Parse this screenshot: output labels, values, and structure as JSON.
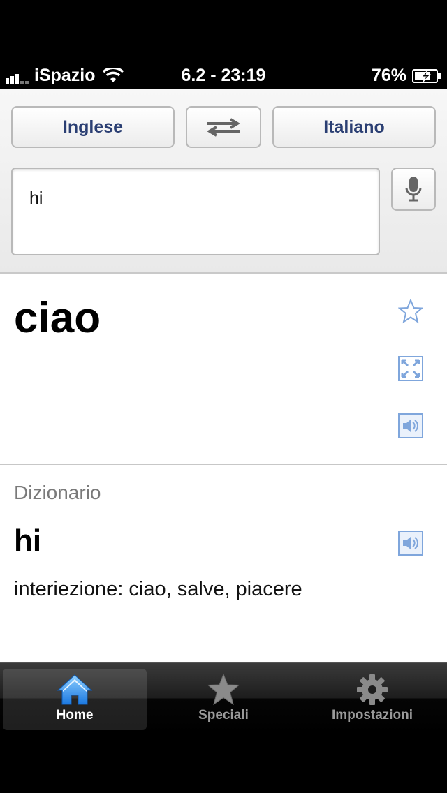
{
  "status": {
    "carrier": "iSpazio",
    "time": "6.2 - 23:19",
    "battery": "76%"
  },
  "languages": {
    "source": "Inglese",
    "target": "Italiano"
  },
  "input": {
    "value": "hi"
  },
  "result": {
    "translation": "ciao"
  },
  "dictionary": {
    "title": "Dizionario",
    "word": "hi",
    "definition": "interiezione: ciao, salve, piacere"
  },
  "tabs": [
    {
      "label": "Home",
      "icon": "home-icon"
    },
    {
      "label": "Speciali",
      "icon": "star-icon"
    },
    {
      "label": "Impostazioni",
      "icon": "gear-icon"
    }
  ],
  "colors": {
    "accent": "#2b3f73",
    "icon_blue": "#5b8fd6"
  }
}
